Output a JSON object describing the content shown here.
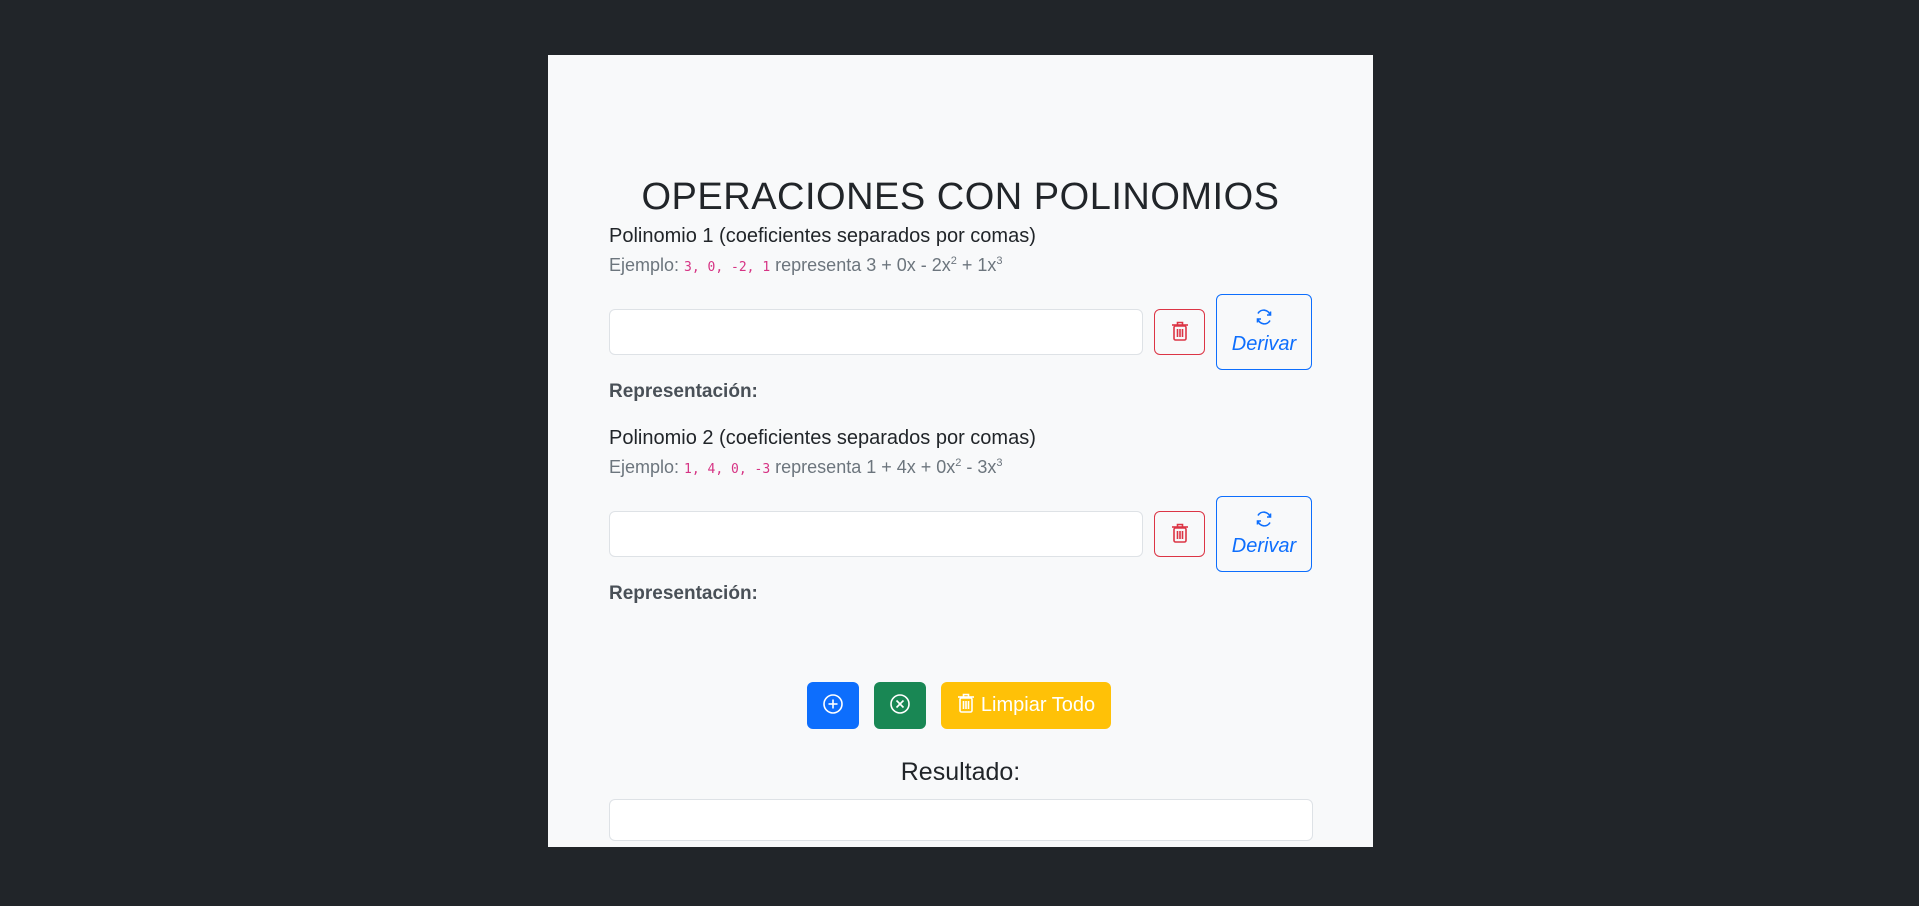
{
  "page": {
    "title": "OPERACIONES CON POLINOMIOS"
  },
  "poly1": {
    "label": "Polinomio 1 (coeficientes separados por comas)",
    "example_prefix": "Ejemplo:",
    "example_code": "3, 0, -2, 1",
    "example_text": "representa 3 + 0x - 2x",
    "example_sup1": "2",
    "example_text2": " + 1x",
    "example_sup2": "3",
    "input_value": "",
    "input_placeholder": "",
    "derive_label": "Derivar",
    "representation_label": "Representación:"
  },
  "poly2": {
    "label": "Polinomio 2 (coeficientes separados por comas)",
    "example_prefix": "Ejemplo:",
    "example_code": "1, 4, 0, -3",
    "example_text": "representa 1 + 4x + 0x",
    "example_sup1": "2",
    "example_text2": " - 3x",
    "example_sup2": "3",
    "input_value": "",
    "input_placeholder": "",
    "derive_label": "Derivar",
    "representation_label": "Representación:"
  },
  "actions": {
    "add_icon": "plus-circle-icon",
    "subtract_icon": "x-circle-icon",
    "clear_all_label": "Limpiar Todo"
  },
  "result": {
    "title": "Resultado:",
    "value": ""
  },
  "colors": {
    "background": "#212529",
    "card": "#f8f9fa",
    "primary": "#0d6efd",
    "success": "#198754",
    "warning": "#ffc107",
    "danger": "#dc3545"
  }
}
